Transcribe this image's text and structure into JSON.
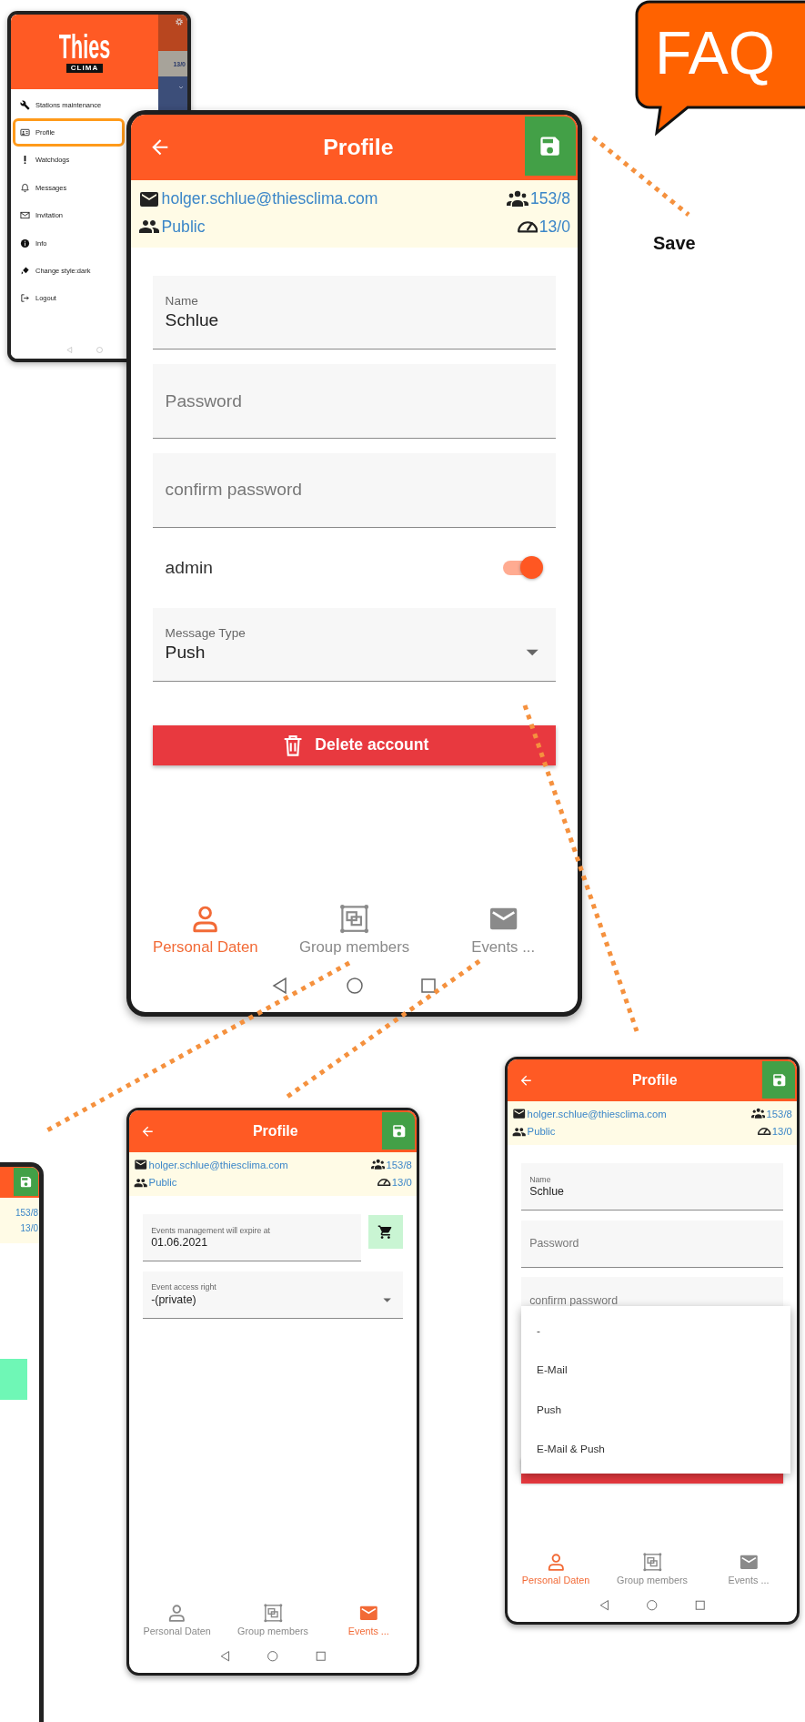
{
  "faq_badge": "FAQ",
  "menu_screen": {
    "logo_title": "Thies",
    "logo_subtitle": "CLIMA",
    "background_reading": "13/0",
    "items": [
      {
        "label": "Stations maintenance",
        "selected": false
      },
      {
        "label": "Profile",
        "selected": true
      },
      {
        "label": "Watchdogs",
        "selected": false
      },
      {
        "label": "Messages",
        "selected": false
      },
      {
        "label": "Invitation",
        "selected": false
      },
      {
        "label": "Info",
        "selected": false
      },
      {
        "label": "Change style:dark",
        "selected": false
      },
      {
        "label": "Logout",
        "selected": false
      }
    ]
  },
  "main_screen": {
    "header": {
      "title": "Profile",
      "email": "holger.schlue@thiesclima.com",
      "visibility": "Public",
      "members_count": "153/8",
      "stations_count": "13/0"
    },
    "fields": [
      {
        "kind": "text",
        "label": "Name",
        "value": "Schlue"
      },
      {
        "kind": "text",
        "placeholder": "Password"
      },
      {
        "kind": "text",
        "placeholder": "confirm password"
      },
      {
        "kind": "switch",
        "label": "admin",
        "on": true
      },
      {
        "kind": "select",
        "label": "Message Type",
        "value": "Push"
      }
    ],
    "delete_button": "Delete account",
    "tabs": [
      {
        "label": "Personal Daten",
        "selected": true
      },
      {
        "label": "Group members",
        "selected": false
      },
      {
        "label": "Events ...",
        "selected": false
      }
    ]
  },
  "save_callout": "Save",
  "cut_screen": {
    "members_count": "153/8",
    "stations_count": "13/0"
  },
  "events_screen": {
    "header": {
      "title": "Profile",
      "email": "holger.schlue@thiesclima.com",
      "visibility": "Public",
      "members_count": "153/8",
      "stations_count": "13/0"
    },
    "fields": [
      {
        "kind": "text_with_button",
        "label": "Events management will expire at",
        "value": "01.06.2021"
      },
      {
        "kind": "select",
        "label": "Event access right",
        "value": "-(private)"
      }
    ],
    "tabs": [
      {
        "label": "Personal Daten",
        "selected": false
      },
      {
        "label": "Group members",
        "selected": false
      },
      {
        "label": "Events ...",
        "selected": true
      }
    ]
  },
  "dropdown_screen": {
    "header": {
      "title": "Profile",
      "email": "holger.schlue@thiesclima.com",
      "visibility": "Public",
      "members_count": "153/8",
      "stations_count": "13/0"
    },
    "fields": [
      {
        "kind": "text",
        "label": "Name",
        "value": "Schlue"
      },
      {
        "kind": "text",
        "placeholder": "Password"
      },
      {
        "kind": "text",
        "placeholder": "confirm password"
      }
    ],
    "menu_options": [
      "-",
      "E-Mail",
      "Push",
      "E-Mail & Push"
    ],
    "tabs": [
      {
        "label": "Personal Daten",
        "selected": true
      },
      {
        "label": "Group members",
        "selected": false
      },
      {
        "label": "Events ...",
        "selected": false
      }
    ]
  }
}
